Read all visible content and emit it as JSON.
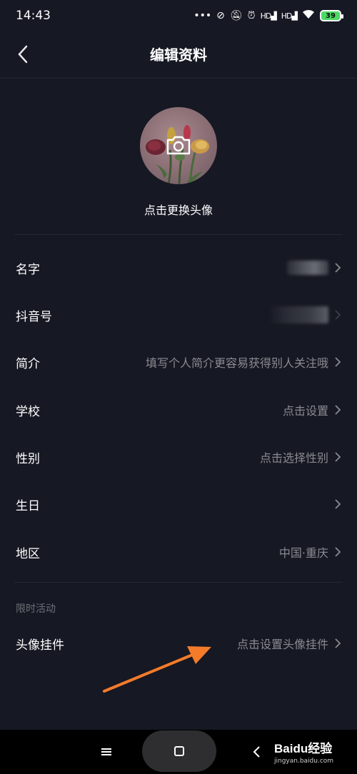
{
  "status_bar": {
    "time": "14:43",
    "dots": "•••",
    "battery": "39",
    "signal1": "HD",
    "signal2": "HD"
  },
  "header": {
    "title": "编辑资料",
    "back_icon": "chevron-left-icon"
  },
  "avatar": {
    "hint": "点击更换头像",
    "camera_icon": "camera-icon"
  },
  "fields": [
    {
      "label": "名字",
      "value": ""
    },
    {
      "label": "抖音号",
      "value": ""
    },
    {
      "label": "简介",
      "value": "填写个人简介更容易获得别人关注哦"
    },
    {
      "label": "学校",
      "value": "点击设置"
    },
    {
      "label": "性别",
      "value": "点击选择性别"
    },
    {
      "label": "生日",
      "value": ""
    },
    {
      "label": "地区",
      "value": "中国·重庆"
    }
  ],
  "limited": {
    "section_title": "限时活动",
    "label": "头像挂件",
    "value": "点击设置头像挂件"
  },
  "system_nav": {
    "menu_icon": "menu-icon",
    "home_icon": "home-square-icon",
    "back_icon": "back-icon"
  },
  "watermark": {
    "brand": "Baidu经验",
    "sub": "jingyan.baidu.com"
  },
  "colors": {
    "background": "#161823",
    "divider": "#262833",
    "secondary_text": "#8a8b91",
    "annotation_arrow": "#f47b2a"
  }
}
